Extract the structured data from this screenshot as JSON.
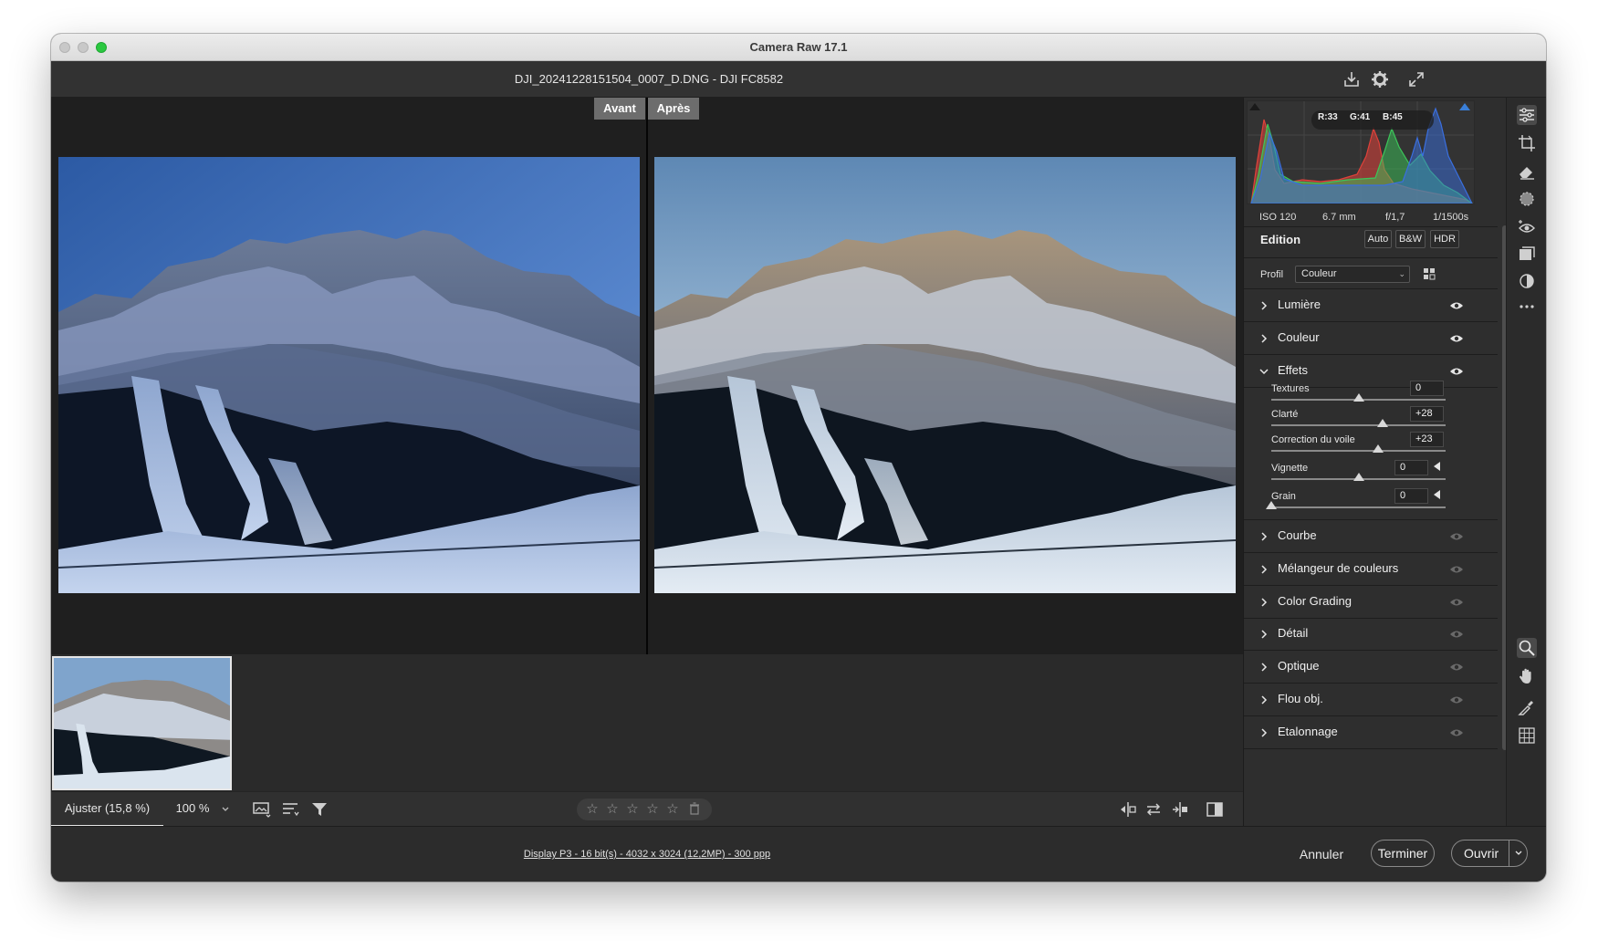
{
  "window": {
    "title": "Camera Raw 17.1"
  },
  "header": {
    "file_title": "DJI_20241228151504_0007_D.DNG  -  DJI FC8582"
  },
  "compare": {
    "before_label": "Avant",
    "after_label": "Après"
  },
  "bottom_bar": {
    "zoom_fit": "Ajuster (15,8 %)",
    "zoom_100": "100 %",
    "rating": {
      "stars": 0,
      "max_stars": 5
    }
  },
  "footer": {
    "display_info": "Display P3 - 16 bit(s) - 4032 x 3024 (12,2MP) - 300 ppp",
    "cancel_label": "Annuler",
    "done_label": "Terminer",
    "open_label": "Ouvrir"
  },
  "histogram": {
    "r_label": "R:",
    "r_value": "33",
    "g_label": "G:",
    "g_value": "41",
    "b_label": "B:",
    "b_value": "45"
  },
  "exif": {
    "iso": "ISO 120",
    "focal": "6.7 mm",
    "aperture": "f/1,7",
    "shutter": "1/1500s"
  },
  "edit_panel": {
    "title": "Edition",
    "auto_label": "Auto",
    "bw_label": "B&W",
    "hdr_label": "HDR",
    "profile_label": "Profil",
    "profile_value": "Couleur",
    "sections_top": [
      {
        "label": "Lumière"
      },
      {
        "label": "Couleur"
      },
      {
        "label": "Effets"
      }
    ],
    "effects_sliders": [
      {
        "label": "Textures",
        "value": "0",
        "position": 0.5
      },
      {
        "label": "Clarté",
        "value": "+28",
        "position": 0.64
      },
      {
        "label": "Correction du voile",
        "value": "+23",
        "position": 0.615
      },
      {
        "label": "Vignette",
        "value": "0",
        "position": 0.5
      },
      {
        "label": "Grain",
        "value": "0",
        "position": 0.0
      }
    ],
    "sections_bottom": [
      {
        "label": "Courbe"
      },
      {
        "label": "Mélangeur de couleurs"
      },
      {
        "label": "Color Grading"
      },
      {
        "label": "Détail"
      },
      {
        "label": "Optique"
      },
      {
        "label": "Flou obj."
      },
      {
        "label": "Etalonnage"
      }
    ]
  },
  "colors": {
    "eye_active": "#e6e6e6",
    "eye_inactive": "#6a6a6a",
    "histogram_red": "#e0413a",
    "histogram_green": "#3cc65a",
    "histogram_blue": "#3a6fe0"
  }
}
